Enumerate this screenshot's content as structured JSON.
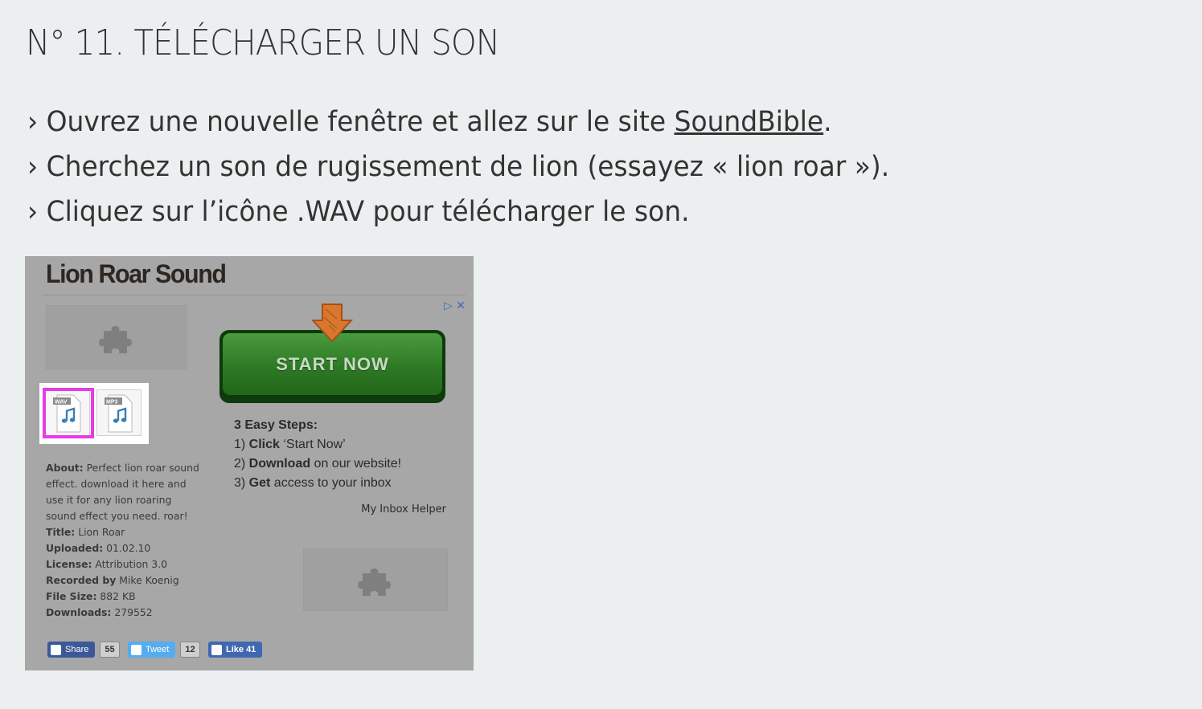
{
  "heading": "N° 11. TÉLÉCHARGER UN SON",
  "instructions": [
    {
      "prefix": "› Ouvrez une nouvelle fenêtre et allez sur le site ",
      "link": "SoundBible",
      "suffix": "."
    },
    {
      "text": "› Cherchez un son de rugissement de lion (essayez « lion roar »)."
    },
    {
      "text": "› Cliquez sur l’icône .WAV pour télécharger le son."
    }
  ],
  "screenshot": {
    "title": "Lion Roar Sound",
    "file_icons": [
      {
        "label": "WAV",
        "icon": "wav-file-icon",
        "highlighted": true
      },
      {
        "label": "MP3",
        "icon": "mp3-file-icon",
        "highlighted": false
      }
    ],
    "highlight_color": "#e63be6",
    "about": {
      "about_label": "About:",
      "about_lines": [
        "Perfect lion roar sound",
        "effect. download it here and",
        "use it for any lion roaring",
        "sound effect you need. roar!"
      ],
      "rows": [
        {
          "label": "Title:",
          "value": "Lion Roar"
        },
        {
          "label": "Uploaded:",
          "value": "01.02.10"
        },
        {
          "label": "License:",
          "value": "Attribution 3.0"
        },
        {
          "label": "Recorded by",
          "value": "Mike Koenig"
        },
        {
          "label": "File Size:",
          "value": "882 KB"
        },
        {
          "label": "Downloads:",
          "value": "279552"
        }
      ]
    },
    "ad": {
      "marks": "▷ ✕",
      "button_label": "START NOW",
      "steps_title": "3 Easy Steps:",
      "steps": [
        {
          "num": "1) ",
          "bold": "Click",
          "rest": " ‘Start Now’"
        },
        {
          "num": "2) ",
          "bold": "Download",
          "rest": " on our website!"
        },
        {
          "num": "3) ",
          "bold": "Get",
          "rest": " access to your inbox"
        }
      ],
      "advertiser": "My Inbox Helper"
    },
    "social": {
      "share_label": "Share",
      "share_count": "55",
      "share_color": "#3b5998",
      "tweet_label": "Tweet",
      "tweet_count": "12",
      "tweet_color": "#55acee",
      "like_label": "Like 41",
      "like_color": "#4267b2"
    }
  }
}
